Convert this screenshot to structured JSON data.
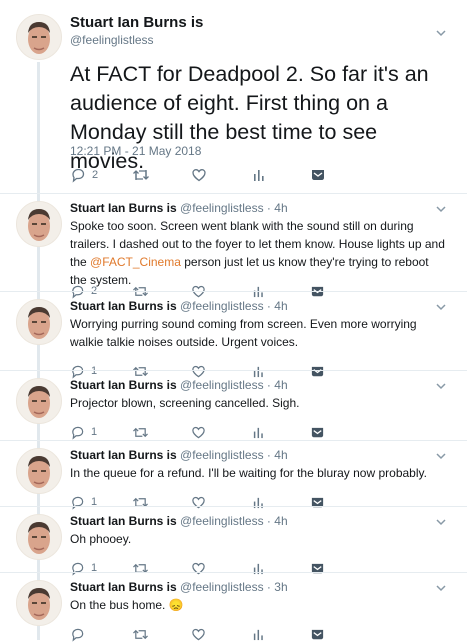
{
  "main": {
    "name": "Stuart Ian Burns is",
    "handle": "@feelinglistless",
    "text": "At FACT for Deadpool 2. So far it's an audience of eight. First thing on a Monday still the best time to see movies.",
    "timestamp": "12:21 PM - 21 May 2018",
    "reply_count": "2"
  },
  "replies": [
    {
      "name": "Stuart Ian Burns is",
      "handle": "@feelinglistless",
      "sep": " · ",
      "time": "4h",
      "text_before": "Spoke too soon. Screen went blank with the sound still on during trailers. I dashed out to the foyer to let them know. House lights up and the ",
      "mention": "@FACT_Cinema",
      "text_after": " person just let us know they're trying to reboot the system.",
      "reply_count": "2"
    },
    {
      "name": "Stuart Ian Burns is",
      "handle": "@feelinglistless",
      "sep": " · ",
      "time": "4h",
      "text": "Worrying purring sound coming from screen.  Even more worrying walkie talkie noises outside. Urgent voices.",
      "reply_count": "1"
    },
    {
      "name": "Stuart Ian Burns is",
      "handle": "@feelinglistless",
      "sep": " · ",
      "time": "4h",
      "text": "Projector blown, screening cancelled. Sigh.",
      "reply_count": "1"
    },
    {
      "name": "Stuart Ian Burns is",
      "handle": "@feelinglistless",
      "sep": " · ",
      "time": "4h",
      "text": "In the queue for a refund. I'll be waiting for the bluray now probably.",
      "reply_count": "1"
    },
    {
      "name": "Stuart Ian Burns is",
      "handle": "@feelinglistless",
      "sep": " · ",
      "time": "4h",
      "text": "Oh phooey.",
      "reply_count": "1"
    },
    {
      "name": "Stuart Ian Burns is",
      "handle": "@feelinglistless",
      "sep": " · ",
      "time": "3h",
      "text": "On the bus home. 😞",
      "reply_count": ""
    }
  ],
  "colors": {
    "icon_gray": "#657786",
    "mention": "#e0792b",
    "divider": "#e6ecf0",
    "thread_line": "#e1e8ed"
  },
  "icons": [
    "avatar",
    "chevron-down-icon",
    "reply-icon",
    "retweet-icon",
    "like-icon",
    "analytics-icon",
    "direct-message-icon"
  ]
}
